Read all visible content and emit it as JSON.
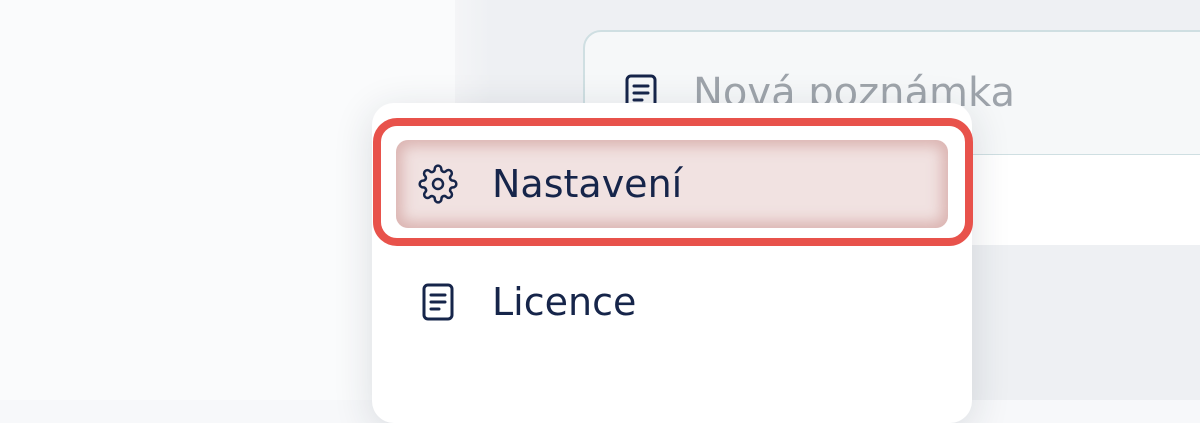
{
  "note_input": {
    "placeholder": "Nová poznámka",
    "icon": "document-icon"
  },
  "menu": {
    "items": [
      {
        "label": "Nastavení",
        "icon": "gear-icon",
        "highlighted": true
      },
      {
        "label": "Licence",
        "icon": "document-icon",
        "highlighted": false
      }
    ]
  },
  "colors": {
    "text": "#16254a",
    "highlight_ring": "#e8524b",
    "placeholder": "#9ea4ab",
    "input_border": "#cfdfe2"
  }
}
